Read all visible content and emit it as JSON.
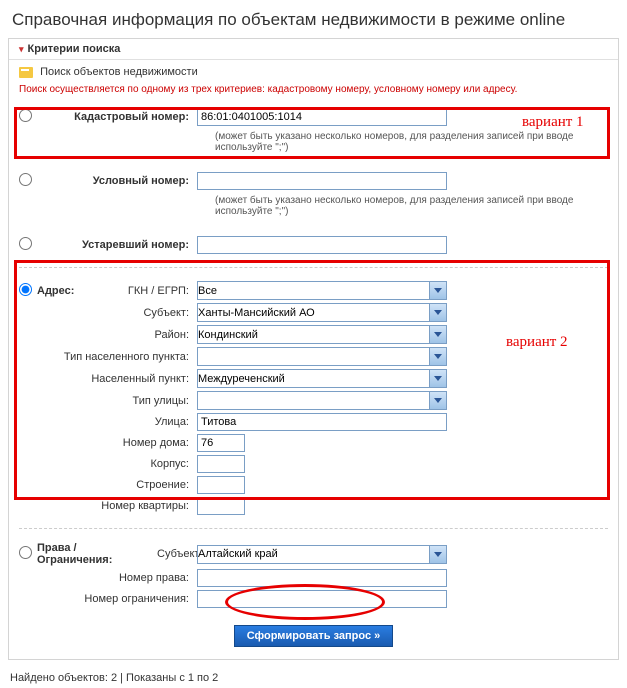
{
  "title": "Справочная информация по объектам недвижимости в режиме online",
  "criteria_header": "Критерии поиска",
  "search_objects_label": "Поиск объектов недвижимости",
  "hint": "Поиск осуществляется по одному из трех критериев: кадастровому номеру, условному номеру или адресу.",
  "cadastral": {
    "label": "Кадастровый номер:",
    "value": "86:01:0401005:1014",
    "help": "(может быть указано несколько номеров, для разделения записей при вводе используйте \";\")"
  },
  "conditional": {
    "label": "Условный номер:",
    "value": "",
    "help": "(может быть указано несколько номеров, для разделения записей при вводе используйте \";\")"
  },
  "obsolete": {
    "label": "Устаревший номер:",
    "value": ""
  },
  "address": {
    "label": "Адрес:",
    "gkn_label": "ГКН / ЕГРП:",
    "gkn_value": "Все",
    "subject_label": "Субъект:",
    "subject_value": "Ханты-Мансийский АО",
    "district_label": "Район:",
    "district_value": "Кондинский",
    "settlement_type_label": "Тип населенного пункта:",
    "settlement_type_value": "",
    "settlement_label": "Населенный пункт:",
    "settlement_value": "Междуреченский",
    "street_type_label": "Тип улицы:",
    "street_type_value": "",
    "street_label": "Улица:",
    "street_value": "Титова",
    "house_label": "Номер дома:",
    "house_value": "76",
    "korpus_label": "Корпус:",
    "korpus_value": "",
    "building_label": "Строение:",
    "building_value": "",
    "apt_label": "Номер квартиры:",
    "apt_value": ""
  },
  "rights": {
    "label": "Права / Ограничения:",
    "subject_label": "Субъект:",
    "subject_value": "Алтайский край",
    "right_no_label": "Номер права:",
    "right_no_value": "",
    "restriction_no_label": "Номер ограничения:",
    "restriction_no_value": ""
  },
  "submit_label": "Сформировать запрос »",
  "footer": "Найдено объектов: 2 | Показаны с 1 по 2",
  "overlay": {
    "v1": "вариант 1",
    "v2": "вариант 2"
  }
}
